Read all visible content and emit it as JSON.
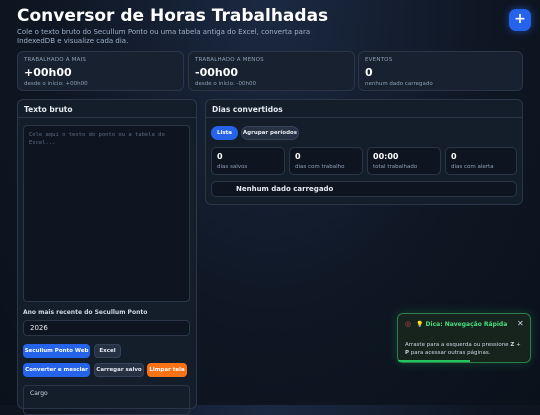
{
  "header": {
    "title": "Conversor de Horas Trabalhadas",
    "subtitle": "Cole o texto bruto do Secullum Ponto ou uma tabela antiga do Excel, converta para IndexedDB e visualize cada dia.",
    "fab_label": "+"
  },
  "stats": [
    {
      "label": "TRABALHADO A MAIS",
      "value": "+00h00",
      "sub": "desde o início: +00h00"
    },
    {
      "label": "TRABALHADO A MENOS",
      "value": "-00h00",
      "sub": "desde o início: -00h00"
    },
    {
      "label": "EVENTOS",
      "value": "0",
      "sub": "nenhum dado carregado"
    }
  ],
  "left_panel": {
    "title": "Texto bruto",
    "placeholder": "Cole aqui o texto do ponto ou a tabela do Excel...",
    "year_label": "Ano mais recente do Secullum Ponto",
    "year_value": "2026",
    "buttons": {
      "secullum": "Secullum Ponto Web",
      "excel": "Excel",
      "convert": "Converter e mesclar",
      "load": "Carregar salvo",
      "clear": "Limpar tela"
    },
    "cargo_label": "Cargo"
  },
  "right_panel": {
    "title": "Dias convertidos",
    "tabs": {
      "list": "Lista",
      "group": "Agrupar períodos"
    },
    "cards": [
      {
        "value": "0",
        "label": "dias salvos"
      },
      {
        "value": "0",
        "label": "dias com trabalho"
      },
      {
        "value": "00:00",
        "label": "total trabalhado"
      },
      {
        "value": "0",
        "label": "dias com alerta"
      }
    ],
    "empty_text": "Nenhum dado carregado"
  },
  "toast": {
    "icon": "target-icon",
    "title": "💡 Dica: Navegação Rápida",
    "body_pre": "Arraste para a esquerda ou pressione ",
    "key_z": "Z",
    "key_sep": " + ",
    "key_p": "P",
    "body_post": " para acessar outras páginas.",
    "close": "✕"
  },
  "colors": {
    "accent": "#2563eb",
    "warning": "#f97316",
    "success": "#22c55e"
  }
}
